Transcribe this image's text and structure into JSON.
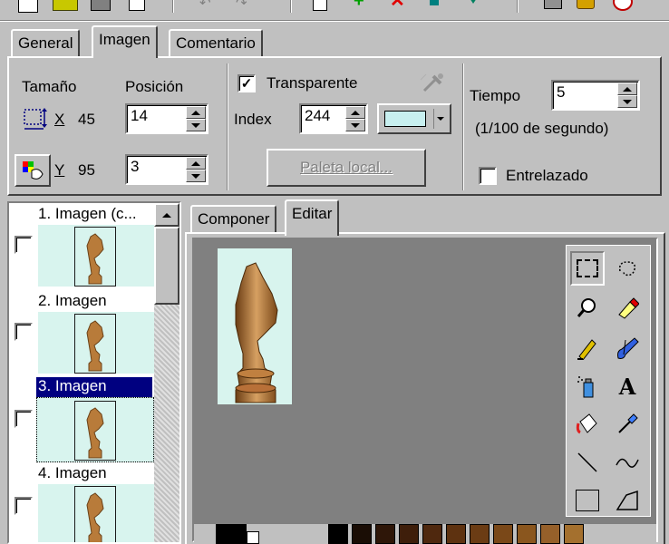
{
  "tabs": [
    {
      "label": "General"
    },
    {
      "label": "Imagen"
    },
    {
      "label": "Comentario"
    }
  ],
  "size_section": {
    "size_label": "Tamaño",
    "position_label": "Posición",
    "x_label": "X",
    "x_value": "45",
    "y_label": "Y",
    "y_value": "95",
    "pos_x": "14",
    "pos_y": "3"
  },
  "transparency": {
    "checkbox_label": "Transparente",
    "checked": true,
    "index_label": "Index",
    "index_value": "244",
    "color": "#c8f0f0",
    "palette_button": "Paleta local..."
  },
  "timing": {
    "time_label": "Tiempo",
    "time_value": "5",
    "time_hint": "(1/100 de segundo)",
    "interlaced_label": "Entrelazado",
    "interlaced_checked": false
  },
  "frames": [
    {
      "label": "1. Imagen (c...",
      "selected": false
    },
    {
      "label": "2. Imagen",
      "selected": false
    },
    {
      "label": "3. Imagen",
      "selected": true
    },
    {
      "label": "4. Imagen",
      "selected": false
    }
  ],
  "editor_tabs": [
    {
      "label": "Componer"
    },
    {
      "label": "Editar"
    }
  ],
  "tools": [
    "rect-select-icon",
    "lasso-select-icon",
    "zoom-icon",
    "eraser-icon",
    "pencil-icon",
    "brush-icon",
    "spray-icon",
    "text-icon",
    "fill-icon",
    "eyedropper-icon",
    "line-icon",
    "curve-icon",
    "rectangle-icon",
    "polygon-icon"
  ],
  "text_tool_glyph": "A",
  "palette_colors": [
    "#000000",
    "#ffffff",
    "#1a0d05",
    "#2e1608",
    "#3e1e0a",
    "#4f280e",
    "#5e3210",
    "#6b3c14",
    "#7a4818",
    "#8a561e",
    "#96602a",
    "#a4702e"
  ]
}
